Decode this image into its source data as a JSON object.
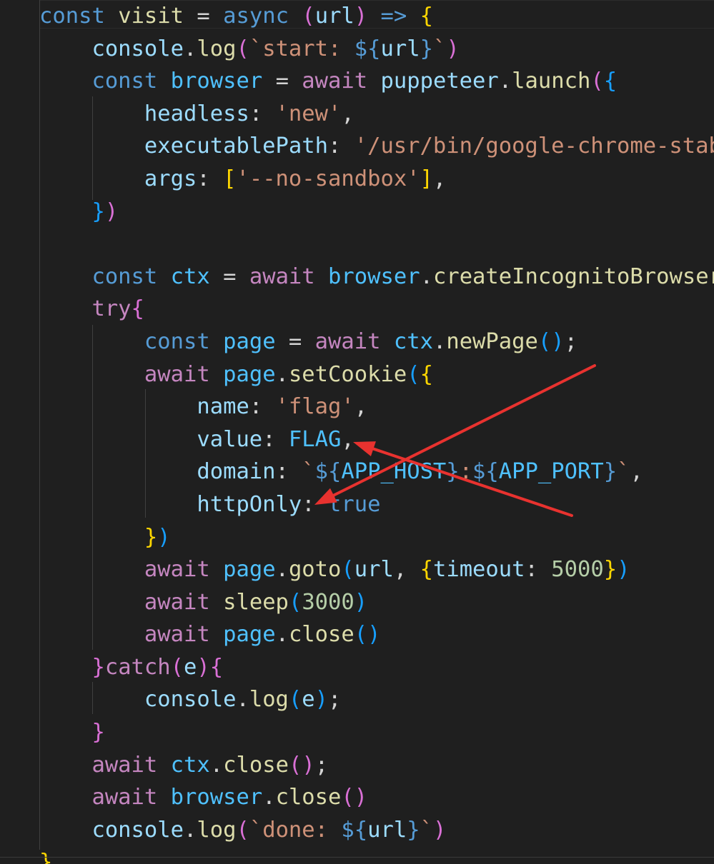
{
  "editor": {
    "lines": [
      [
        [
          "kw",
          "const"
        ],
        [
          "pun",
          " "
        ],
        [
          "fn",
          "visit"
        ],
        [
          "pun",
          " = "
        ],
        [
          "kw",
          "async"
        ],
        [
          "pun",
          " "
        ],
        [
          "b2",
          "("
        ],
        [
          "var",
          "url"
        ],
        [
          "b2",
          ")"
        ],
        [
          "pun",
          " "
        ],
        [
          "kw",
          "=>"
        ],
        [
          "pun",
          " "
        ],
        [
          "b1",
          "{"
        ]
      ],
      [
        [
          "pun",
          "    "
        ],
        [
          "var",
          "console"
        ],
        [
          "pun",
          "."
        ],
        [
          "fn",
          "log"
        ],
        [
          "b2",
          "("
        ],
        [
          "str",
          "`start: "
        ],
        [
          "kw",
          "${"
        ],
        [
          "var",
          "url"
        ],
        [
          "kw",
          "}"
        ],
        [
          "str",
          "`"
        ],
        [
          "b2",
          ")"
        ]
      ],
      [
        [
          "pun",
          "    "
        ],
        [
          "kw",
          "const"
        ],
        [
          "pun",
          " "
        ],
        [
          "con",
          "browser"
        ],
        [
          "pun",
          " = "
        ],
        [
          "ctl",
          "await"
        ],
        [
          "pun",
          " "
        ],
        [
          "var",
          "puppeteer"
        ],
        [
          "pun",
          "."
        ],
        [
          "fn",
          "launch"
        ],
        [
          "b2",
          "("
        ],
        [
          "b3",
          "{"
        ]
      ],
      [
        [
          "pun",
          "        "
        ],
        [
          "var",
          "headless"
        ],
        [
          "pun",
          ": "
        ],
        [
          "str",
          "'new'"
        ],
        [
          "pun",
          ","
        ]
      ],
      [
        [
          "pun",
          "        "
        ],
        [
          "var",
          "executablePath"
        ],
        [
          "pun",
          ": "
        ],
        [
          "str",
          "'/usr/bin/google-chrome-stable'"
        ],
        [
          "pun",
          ","
        ]
      ],
      [
        [
          "pun",
          "        "
        ],
        [
          "var",
          "args"
        ],
        [
          "pun",
          ": "
        ],
        [
          "b1",
          "["
        ],
        [
          "str",
          "'--no-sandbox'"
        ],
        [
          "b1",
          "]"
        ],
        [
          "pun",
          ","
        ]
      ],
      [
        [
          "pun",
          "    "
        ],
        [
          "b3",
          "}"
        ],
        [
          "b2",
          ")"
        ]
      ],
      [
        [
          "pun",
          " "
        ]
      ],
      [
        [
          "pun",
          "    "
        ],
        [
          "kw",
          "const"
        ],
        [
          "pun",
          " "
        ],
        [
          "con",
          "ctx"
        ],
        [
          "pun",
          " = "
        ],
        [
          "ctl",
          "await"
        ],
        [
          "pun",
          " "
        ],
        [
          "con",
          "browser"
        ],
        [
          "pun",
          "."
        ],
        [
          "fn",
          "createIncognitoBrowserContext"
        ],
        [
          "b2",
          "("
        ],
        [
          "b2",
          ")"
        ],
        [
          "pun",
          ";"
        ]
      ],
      [
        [
          "pun",
          "    "
        ],
        [
          "ctl",
          "try"
        ],
        [
          "b2",
          "{"
        ]
      ],
      [
        [
          "pun",
          "        "
        ],
        [
          "kw",
          "const"
        ],
        [
          "pun",
          " "
        ],
        [
          "con",
          "page"
        ],
        [
          "pun",
          " = "
        ],
        [
          "ctl",
          "await"
        ],
        [
          "pun",
          " "
        ],
        [
          "con",
          "ctx"
        ],
        [
          "pun",
          "."
        ],
        [
          "fn",
          "newPage"
        ],
        [
          "b3",
          "("
        ],
        [
          "b3",
          ")"
        ],
        [
          "pun",
          ";"
        ]
      ],
      [
        [
          "pun",
          "        "
        ],
        [
          "ctl",
          "await"
        ],
        [
          "pun",
          " "
        ],
        [
          "con",
          "page"
        ],
        [
          "pun",
          "."
        ],
        [
          "fn",
          "setCookie"
        ],
        [
          "b3",
          "("
        ],
        [
          "b1",
          "{"
        ]
      ],
      [
        [
          "pun",
          "            "
        ],
        [
          "var",
          "name"
        ],
        [
          "pun",
          ": "
        ],
        [
          "str",
          "'flag'"
        ],
        [
          "pun",
          ","
        ]
      ],
      [
        [
          "pun",
          "            "
        ],
        [
          "var",
          "value"
        ],
        [
          "pun",
          ": "
        ],
        [
          "con",
          "FLAG"
        ],
        [
          "pun",
          ","
        ]
      ],
      [
        [
          "pun",
          "            "
        ],
        [
          "var",
          "domain"
        ],
        [
          "pun",
          ": "
        ],
        [
          "str",
          "`"
        ],
        [
          "kw",
          "${"
        ],
        [
          "con",
          "APP_HOST"
        ],
        [
          "kw",
          "}"
        ],
        [
          "str",
          ":"
        ],
        [
          "kw",
          "${"
        ],
        [
          "con",
          "APP_PORT"
        ],
        [
          "kw",
          "}"
        ],
        [
          "str",
          "`"
        ],
        [
          "pun",
          ","
        ]
      ],
      [
        [
          "pun",
          "            "
        ],
        [
          "var",
          "httpOnly"
        ],
        [
          "pun",
          ": "
        ],
        [
          "kw",
          "true"
        ]
      ],
      [
        [
          "pun",
          "        "
        ],
        [
          "b1",
          "}"
        ],
        [
          "b3",
          ")"
        ]
      ],
      [
        [
          "pun",
          "        "
        ],
        [
          "ctl",
          "await"
        ],
        [
          "pun",
          " "
        ],
        [
          "con",
          "page"
        ],
        [
          "pun",
          "."
        ],
        [
          "fn",
          "goto"
        ],
        [
          "b3",
          "("
        ],
        [
          "var",
          "url"
        ],
        [
          "pun",
          ", "
        ],
        [
          "b1",
          "{"
        ],
        [
          "var",
          "timeout"
        ],
        [
          "pun",
          ": "
        ],
        [
          "num",
          "5000"
        ],
        [
          "b1",
          "}"
        ],
        [
          "b3",
          ")"
        ]
      ],
      [
        [
          "pun",
          "        "
        ],
        [
          "ctl",
          "await"
        ],
        [
          "pun",
          " "
        ],
        [
          "fn",
          "sleep"
        ],
        [
          "b3",
          "("
        ],
        [
          "num",
          "3000"
        ],
        [
          "b3",
          ")"
        ]
      ],
      [
        [
          "pun",
          "        "
        ],
        [
          "ctl",
          "await"
        ],
        [
          "pun",
          " "
        ],
        [
          "con",
          "page"
        ],
        [
          "pun",
          "."
        ],
        [
          "fn",
          "close"
        ],
        [
          "b3",
          "("
        ],
        [
          "b3",
          ")"
        ]
      ],
      [
        [
          "pun",
          "    "
        ],
        [
          "b2",
          "}"
        ],
        [
          "ctl",
          "catch"
        ],
        [
          "b2",
          "("
        ],
        [
          "var",
          "e"
        ],
        [
          "b2",
          ")"
        ],
        [
          "b2",
          "{"
        ]
      ],
      [
        [
          "pun",
          "        "
        ],
        [
          "var",
          "console"
        ],
        [
          "pun",
          "."
        ],
        [
          "fn",
          "log"
        ],
        [
          "b3",
          "("
        ],
        [
          "var",
          "e"
        ],
        [
          "b3",
          ")"
        ],
        [
          "pun",
          ";"
        ]
      ],
      [
        [
          "pun",
          "    "
        ],
        [
          "b2",
          "}"
        ]
      ],
      [
        [
          "pun",
          "    "
        ],
        [
          "ctl",
          "await"
        ],
        [
          "pun",
          " "
        ],
        [
          "con",
          "ctx"
        ],
        [
          "pun",
          "."
        ],
        [
          "fn",
          "close"
        ],
        [
          "b2",
          "("
        ],
        [
          "b2",
          ")"
        ],
        [
          "pun",
          ";"
        ]
      ],
      [
        [
          "pun",
          "    "
        ],
        [
          "ctl",
          "await"
        ],
        [
          "pun",
          " "
        ],
        [
          "con",
          "browser"
        ],
        [
          "pun",
          "."
        ],
        [
          "fn",
          "close"
        ],
        [
          "b2",
          "("
        ],
        [
          "b2",
          ")"
        ]
      ],
      [
        [
          "pun",
          "    "
        ],
        [
          "var",
          "console"
        ],
        [
          "pun",
          "."
        ],
        [
          "fn",
          "log"
        ],
        [
          "b2",
          "("
        ],
        [
          "str",
          "`done: "
        ],
        [
          "kw",
          "${"
        ],
        [
          "var",
          "url"
        ],
        [
          "kw",
          "}"
        ],
        [
          "str",
          "`"
        ],
        [
          "b2",
          ")"
        ]
      ],
      [
        [
          "b1",
          "}"
        ]
      ]
    ]
  },
  "annotation": {
    "color": "#e8322f"
  }
}
